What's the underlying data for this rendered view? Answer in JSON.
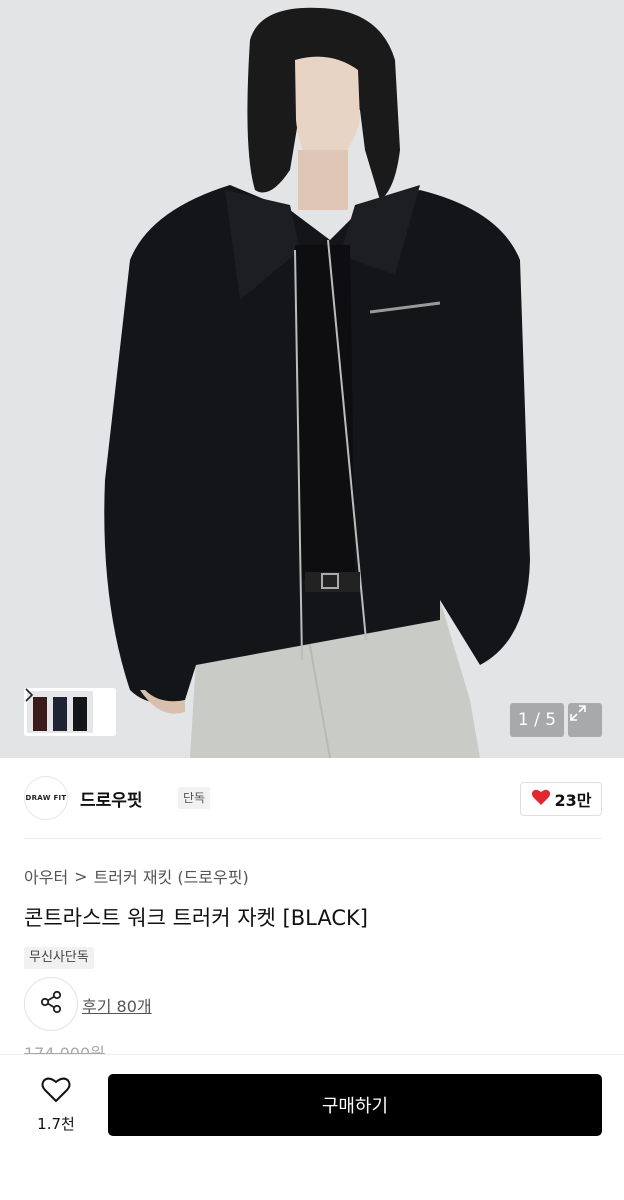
{
  "gallery": {
    "current_page": "1",
    "total_pages": "5",
    "counter_label": "1 / 5"
  },
  "brand": {
    "logo_text": "DRAW FIT",
    "name": "드로우핏",
    "badge": "단독",
    "likes": "23만",
    "like_color": "#e0282e"
  },
  "breadcrumb": {
    "category": "아우터",
    "separator": ">",
    "subcategory": "트러커 재킷 (드로우핏)"
  },
  "product": {
    "title": "콘트라스트 워크 트러커 자켓 [BLACK]",
    "exclusive_badge": "무신사단독",
    "review_link": "후기 80개",
    "original_price": "174,000원"
  },
  "bottom_bar": {
    "wish_count": "1.7천",
    "buy_label": "구매하기"
  },
  "icons": {
    "expand": "expand-icon",
    "heart_filled": "heart-filled-icon",
    "share": "share-icon",
    "heart_outline": "heart-outline-icon",
    "chevron_right": "chevron-right-icon"
  }
}
